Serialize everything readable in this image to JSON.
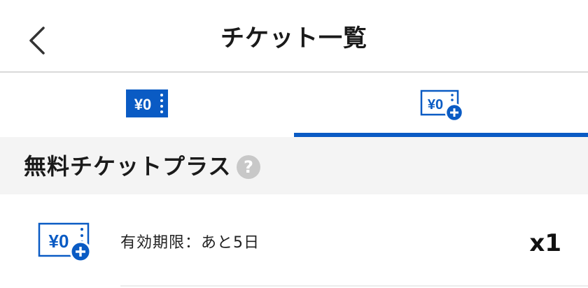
{
  "header": {
    "title": "チケット一覧",
    "back_icon": "chevron-left-icon"
  },
  "tabs": [
    {
      "name": "free-ticket",
      "icon": "yen-zero-ticket-icon",
      "icon_text": "¥0",
      "selected": false
    },
    {
      "name": "free-ticket-plus",
      "icon": "yen-zero-ticket-plus-icon",
      "icon_text": "¥0",
      "selected": true
    }
  ],
  "section": {
    "title": "無料チケットプラス",
    "help_icon": "question-circle-icon",
    "help_glyph": "?"
  },
  "tickets": [
    {
      "icon": "yen-zero-ticket-plus-icon",
      "icon_text": "¥0",
      "expiry": "有効期限：あと5日",
      "count": "x1"
    }
  ],
  "colors": {
    "accent": "#0a5bc4",
    "section_bg": "#f4f4f4",
    "help_icon_bg": "#c8c8c8",
    "divider": "#d9d9d9"
  }
}
